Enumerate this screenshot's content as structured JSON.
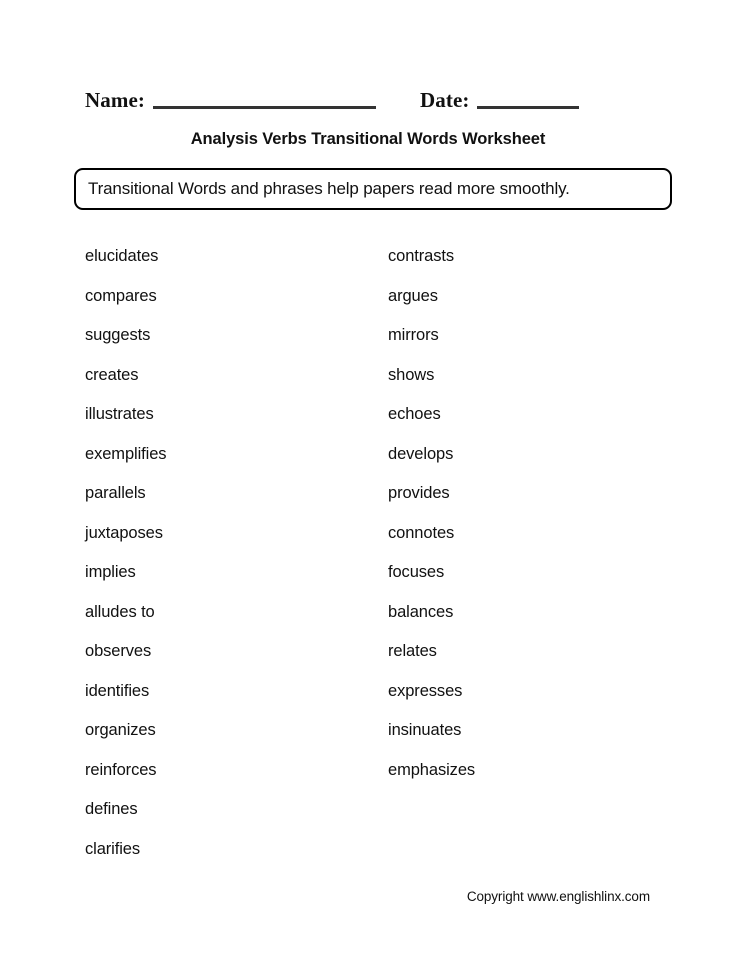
{
  "header": {
    "name_label": "Name:",
    "date_label": "Date:",
    "name_value": "",
    "date_value": "",
    "title": "Analysis Verbs Transitional Words Worksheet"
  },
  "instructions": {
    "text": "Transitional Words and phrases help papers read more smoothly."
  },
  "word_lists": {
    "left_column": [
      "elucidates",
      "compares",
      "suggests",
      "creates",
      "illustrates",
      "exemplifies",
      "parallels",
      "juxtaposes",
      "implies",
      "alludes to",
      "observes",
      "identifies",
      "organizes",
      "reinforces",
      "defines",
      "clarifies"
    ],
    "right_column": [
      "contrasts",
      "argues",
      "mirrors",
      "shows",
      "echoes",
      "develops",
      "provides",
      "connotes",
      "focuses",
      "balances",
      "relates",
      "expresses",
      "insinuates",
      "emphasizes"
    ]
  },
  "footer": {
    "copyright": "Copyright www.englishlinx.com"
  },
  "colors": {
    "text": "#111111",
    "rule": "#333333",
    "border": "#000000",
    "background": "#ffffff"
  }
}
